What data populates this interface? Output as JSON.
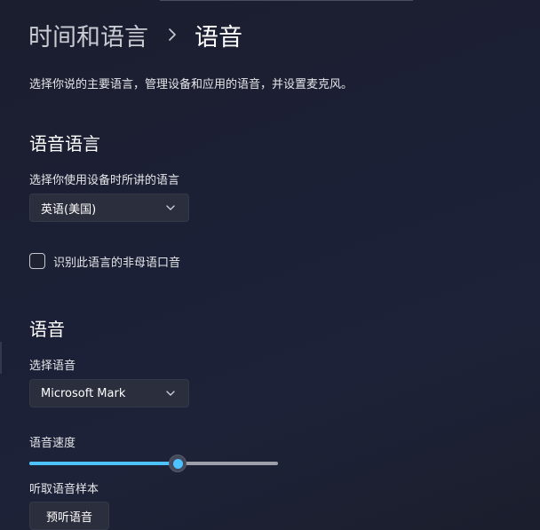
{
  "breadcrumb": {
    "parent": "时间和语言",
    "current": "语音"
  },
  "description": "选择你说的主要语言，管理设备和应用的语音，并设置麦克风。",
  "speech_language": {
    "title": "语音语言",
    "select_label": "选择你使用设备时所讲的语言",
    "selected_value": "英语(美国)",
    "nonnative_checkbox_label": "识别此语言的非母语口音",
    "nonnative_checked": false
  },
  "voices": {
    "title": "语音",
    "select_label": "选择语音",
    "selected_voice": "Microsoft Mark",
    "speed_label": "语音速度",
    "speed_fraction": 0.595,
    "sample_label": "听取语音样本",
    "preview_button": "预听语音"
  },
  "colors": {
    "accent": "#4cc2ff"
  }
}
